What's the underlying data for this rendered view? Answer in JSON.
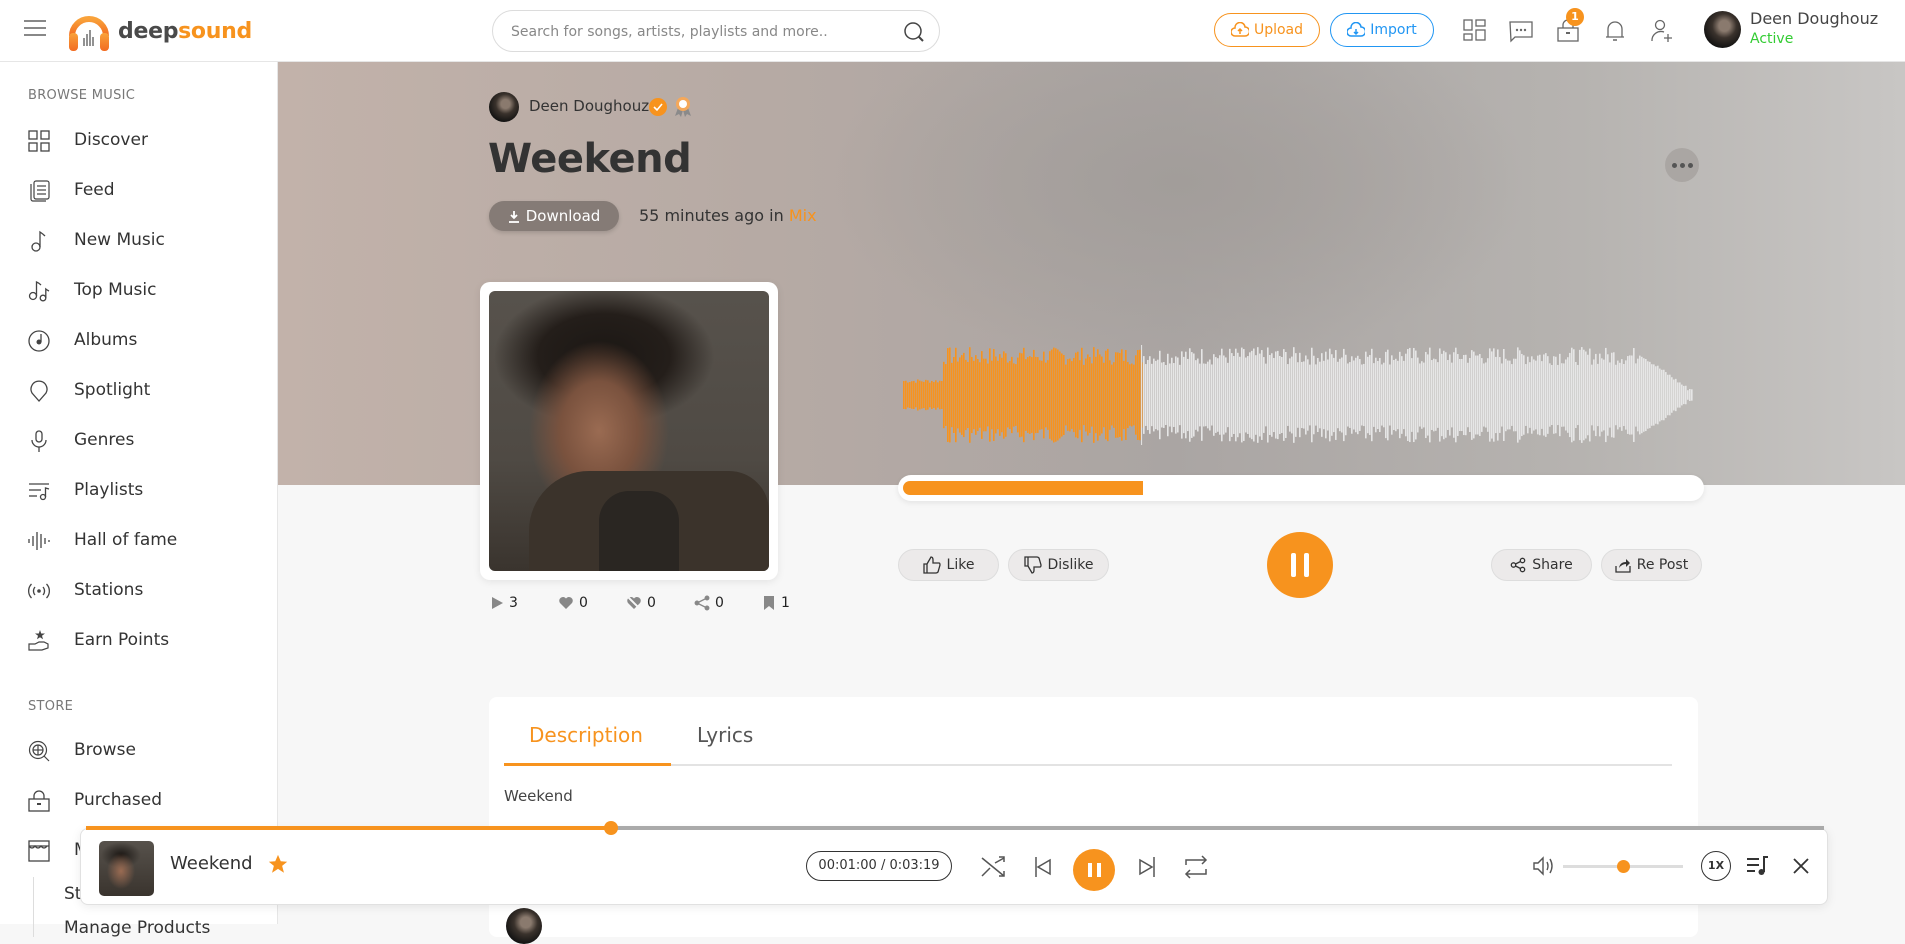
{
  "header": {
    "logo": {
      "part1": "deep",
      "part2": "sound"
    },
    "search_placeholder": "Search for songs, artists, playlists and more..",
    "upload_label": "Upload",
    "import_label": "Import",
    "icons": [
      "apps-grid-icon",
      "messages-icon",
      "purchases-bag-icon",
      "notifications-bell-icon",
      "add-friend-icon"
    ],
    "purchases_badge": "1",
    "user": {
      "name": "Deen Doughouz",
      "status": "Active"
    }
  },
  "sidebar": {
    "browse_heading": "BROWSE MUSIC",
    "browse_items": [
      {
        "label": "Discover",
        "icon": "discover-grid-icon"
      },
      {
        "label": "Feed",
        "icon": "feed-icon"
      },
      {
        "label": "New Music",
        "icon": "music-note-icon"
      },
      {
        "label": "Top Music",
        "icon": "music-notes-icon"
      },
      {
        "label": "Albums",
        "icon": "album-disc-icon"
      },
      {
        "label": "Spotlight",
        "icon": "spotlight-icon"
      },
      {
        "label": "Genres",
        "icon": "microphone-icon"
      },
      {
        "label": "Playlists",
        "icon": "playlist-icon"
      },
      {
        "label": "Hall of fame",
        "icon": "soundwave-icon"
      },
      {
        "label": "Stations",
        "icon": "radio-broadcast-icon"
      },
      {
        "label": "Earn Points",
        "icon": "earn-points-hand-icon"
      }
    ],
    "store_heading": "STORE",
    "store_items": [
      {
        "label": "Browse",
        "icon": "globe-search-icon"
      },
      {
        "label": "Purchased",
        "icon": "shopping-bag-icon"
      },
      {
        "label": "M",
        "icon": "storefront-icon"
      }
    ],
    "store_subitems": [
      "St",
      "Manage Products"
    ]
  },
  "song": {
    "artist": "Deen Doughouz",
    "title": "Weekend",
    "download_label": "Download",
    "time_ago": "55 minutes ago in",
    "category": "Mix",
    "progress_fraction": 0.302,
    "actions": {
      "like": "Like",
      "dislike": "Dislike",
      "share": "Share",
      "repost": "Re Post"
    },
    "stats": [
      {
        "name": "plays",
        "icon": "play-icon",
        "value": "3"
      },
      {
        "name": "likes",
        "icon": "heart-icon",
        "value": "0"
      },
      {
        "name": "dislikes",
        "icon": "broken-heart-icon",
        "value": "0"
      },
      {
        "name": "shares",
        "icon": "share-icon",
        "value": "0"
      },
      {
        "name": "saves",
        "icon": "bookmark-icon",
        "value": "1"
      }
    ]
  },
  "tabs": [
    {
      "label": "Description",
      "active": true
    },
    {
      "label": "Lyrics",
      "active": false
    }
  ],
  "description": "Weekend",
  "player": {
    "title": "Weekend",
    "current_time": "00:01:00",
    "total_time": "0:03:19",
    "time_display": "00:01:00 / 0:03:19",
    "seek_fraction": 0.302,
    "volume_fraction": 0.5,
    "speed": "1X"
  },
  "colors": {
    "accent": "#f7931e",
    "import": "#2196f3",
    "active_status": "#33cc33"
  }
}
